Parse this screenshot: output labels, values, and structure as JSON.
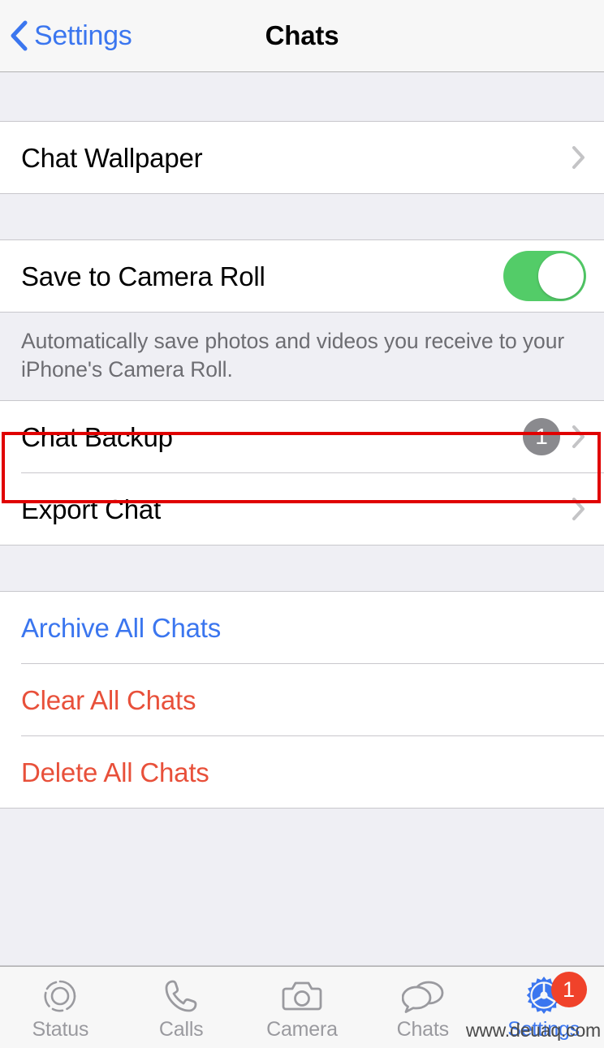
{
  "navbar": {
    "back_label": "Settings",
    "back_icon": "chevron-left-icon",
    "title": "Chats"
  },
  "sections": {
    "wallpaper": {
      "rows": [
        {
          "label": "Chat Wallpaper",
          "accessory": "chevron-right-icon"
        }
      ]
    },
    "media": {
      "rows": [
        {
          "label": "Save to Camera Roll",
          "accessory": "toggle",
          "toggle_on": true
        }
      ],
      "footer": "Automatically save photos and videos you receive to your iPhone's Camera Roll."
    },
    "backup": {
      "rows": [
        {
          "label": "Chat Backup",
          "badge": "1",
          "accessory": "chevron-right-icon",
          "highlighted": true
        },
        {
          "label": "Export Chat",
          "accessory": "chevron-right-icon"
        }
      ]
    },
    "actions": {
      "rows": [
        {
          "label": "Archive All Chats",
          "style": "link"
        },
        {
          "label": "Clear All Chats",
          "style": "destructive"
        },
        {
          "label": "Delete All Chats",
          "style": "destructive"
        }
      ]
    }
  },
  "tabbar": {
    "tabs": [
      {
        "label": "Status",
        "icon": "status-rings-icon",
        "active": false
      },
      {
        "label": "Calls",
        "icon": "phone-icon",
        "active": false
      },
      {
        "label": "Camera",
        "icon": "camera-icon",
        "active": false
      },
      {
        "label": "Chats",
        "icon": "chat-bubbles-icon",
        "active": false
      },
      {
        "label": "Settings",
        "icon": "gear-icon",
        "active": true,
        "badge": "1"
      }
    ]
  },
  "watermark": "www.deuaq.com",
  "colors": {
    "accent_blue": "#3B76EF",
    "destructive_red": "#E8503A",
    "toggle_green": "#53CC68",
    "badge_gray": "#8A8A8E",
    "badge_red": "#F0422A",
    "highlight_red": "#E00000",
    "group_background": "#EFEFF4",
    "row_background": "#FFFFFF"
  }
}
